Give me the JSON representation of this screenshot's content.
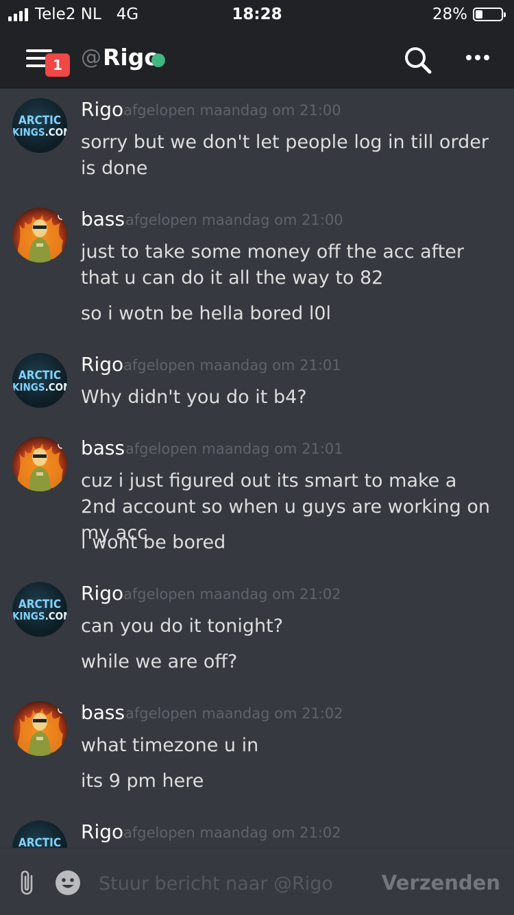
{
  "status_bar": {
    "carrier": "Tele2 NL",
    "network": "4G",
    "time": "18:28",
    "battery_percent": "28%",
    "battery_level": 0.28
  },
  "header": {
    "unread_badge": "1",
    "at_prefix": "@",
    "channel_name": "Rigo",
    "status_color": "#43b581",
    "icons": [
      "menu-icon",
      "search-icon",
      "more-icon"
    ]
  },
  "avatars": {
    "rigo": {
      "line1": "ARCTIC",
      "line2": "KINGS",
      "line2_suffix": ".COM"
    }
  },
  "messages": [
    {
      "author": "Rigo",
      "timestamp": "afgelopen maandag om 21:00",
      "lines": [
        "sorry but we don't let people log in till order is done"
      ]
    },
    {
      "author": "bass",
      "timestamp": "afgelopen maandag om 21:00",
      "lines": [
        "just to take some money off the acc after that u can do it all the way to 82",
        "so i wotn be hella bored l0l"
      ]
    },
    {
      "author": "Rigo",
      "timestamp": "afgelopen maandag om 21:01",
      "lines": [
        "Why didn't you do it b4?"
      ]
    },
    {
      "author": "bass",
      "timestamp": "afgelopen maandag om 21:01",
      "lines": [
        "cuz i just figured out its smart to make a 2nd account so when u guys are working on my acc",
        "i wont be bored"
      ]
    },
    {
      "author": "Rigo",
      "timestamp": "afgelopen maandag om 21:02",
      "lines": [
        "can you do it tonight?",
        "while we are off?"
      ]
    },
    {
      "author": "bass",
      "timestamp": "afgelopen maandag om 21:02",
      "lines": [
        "what timezone u in",
        "its 9 pm here"
      ]
    },
    {
      "author": "Rigo",
      "timestamp": "afgelopen maandag om 21:02",
      "lines": []
    }
  ],
  "composer": {
    "placeholder": "Stuur bericht naar @Rigo",
    "send_label": "Verzenden"
  }
}
